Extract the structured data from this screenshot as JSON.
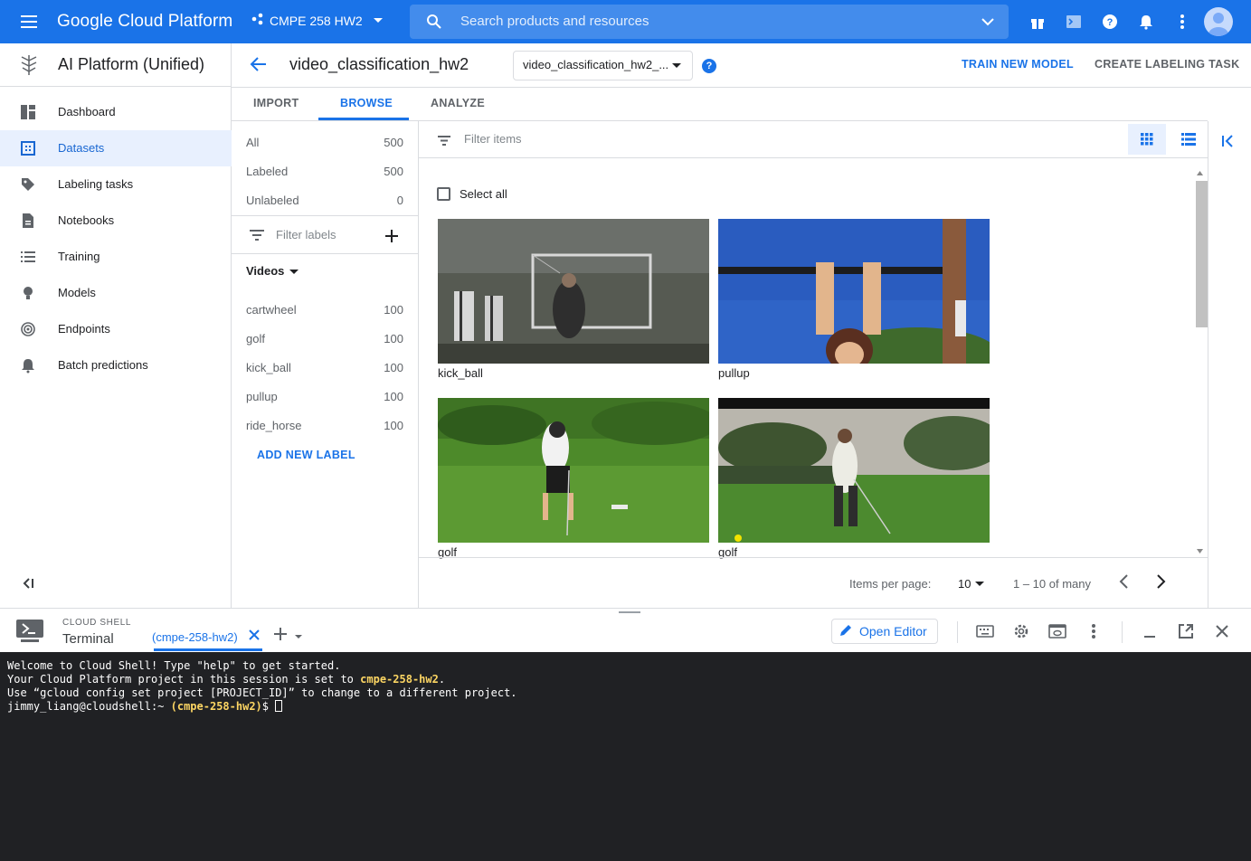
{
  "topbar": {
    "brand": "Google Cloud Platform",
    "project": "CMPE 258 HW2",
    "search_placeholder": "Search products and resources"
  },
  "leftnav": {
    "product": "AI Platform (Unified)",
    "items": [
      {
        "label": "Dashboard"
      },
      {
        "label": "Datasets"
      },
      {
        "label": "Labeling tasks"
      },
      {
        "label": "Notebooks"
      },
      {
        "label": "Training"
      },
      {
        "label": "Models"
      },
      {
        "label": "Endpoints"
      },
      {
        "label": "Batch predictions"
      }
    ],
    "active_index": 1
  },
  "header": {
    "title": "video_classification_hw2",
    "dataset_select": "video_classification_hw2_...",
    "help": "?",
    "train_btn": "TRAIN NEW MODEL",
    "labeling_btn": "CREATE LABELING TASK"
  },
  "tabs": [
    {
      "label": "IMPORT"
    },
    {
      "label": "BROWSE"
    },
    {
      "label": "ANALYZE"
    }
  ],
  "labels_panel": {
    "summary": [
      {
        "name": "All",
        "count": "500"
      },
      {
        "name": "Labeled",
        "count": "500"
      },
      {
        "name": "Unlabeled",
        "count": "0"
      }
    ],
    "filter_placeholder": "Filter labels",
    "group": "Videos",
    "labels": [
      {
        "name": "cartwheel",
        "count": "100"
      },
      {
        "name": "golf",
        "count": "100"
      },
      {
        "name": "kick_ball",
        "count": "100"
      },
      {
        "name": "pullup",
        "count": "100"
      },
      {
        "name": "ride_horse",
        "count": "100"
      }
    ],
    "add_label": "ADD NEW LABEL"
  },
  "items": {
    "filter_placeholder": "Filter items",
    "select_all": "Select all",
    "cards": [
      {
        "label": "kick_ball"
      },
      {
        "label": "pullup"
      },
      {
        "label": "golf"
      },
      {
        "label": "golf"
      }
    ],
    "pager": {
      "items_per_page_label": "Items per page:",
      "items_per_page": "10",
      "range": "1 – 10 of many"
    }
  },
  "shell": {
    "kicker": "CLOUD SHELL",
    "title": "Terminal",
    "tab": "(cmpe-258-hw2)",
    "open_editor": "Open Editor",
    "lines": {
      "l1": "Welcome to Cloud Shell! Type \"help\" to get started.",
      "l2a": "Your Cloud Platform project in this session is set to ",
      "l2b": "cmpe-258-hw2",
      "l2c": ".",
      "l3": "Use “gcloud config set project [PROJECT_ID]” to change to a different project.",
      "l4a": "jimmy_liang@cloudshell:~ ",
      "l4b": "(cmpe-258-hw2)",
      "l4c": "$ "
    }
  },
  "colors": {
    "brand_blue": "#1a73e8",
    "terminal_bg": "#202124",
    "terminal_highlight": "#fdd663"
  }
}
